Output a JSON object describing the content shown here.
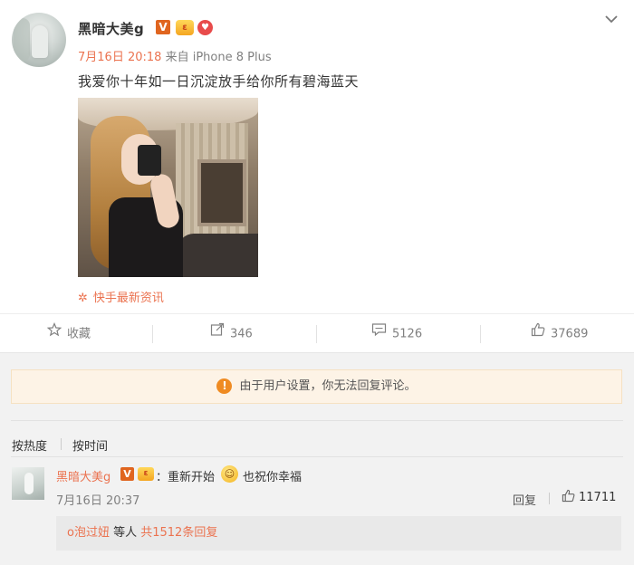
{
  "post": {
    "username": "黑暗大美g",
    "verified_badge": "V",
    "crown_badge": "ε",
    "heart_badge": "♥",
    "time": "7月16日 20:18",
    "source_prefix": "来自",
    "device": "iPhone 8 Plus",
    "text": "我爱你十年如一日沉淀放手给你所有碧海蓝天",
    "source_label": "快手最新资讯",
    "menu_icon": "chevron-down-icon"
  },
  "actions": {
    "favorite_label": "收藏",
    "repost_count": "346",
    "comment_count": "5126",
    "like_count": "37689"
  },
  "comments_section": {
    "notice_text": "由于用户设置，你无法回复评论。",
    "sort_hot": "按热度",
    "sort_time": "按时间",
    "comment": {
      "username": "黑暗大美g",
      "verified_badge": "V",
      "crown_badge": "ε",
      "text_before_emoji": "：重新开始",
      "text_after_emoji": "也祝你幸福",
      "time": "7月16日 20:37",
      "reply_label": "回复",
      "like_count": "11711"
    },
    "replies": {
      "first_user": "o泡过妞",
      "middle": " 等人 ",
      "count_text": "共1512条回复"
    }
  },
  "colors": {
    "accent": "#eb7350",
    "notice_bg": "#fdf3e6",
    "warning": "#ef8b22",
    "badge": "#e0651f"
  }
}
